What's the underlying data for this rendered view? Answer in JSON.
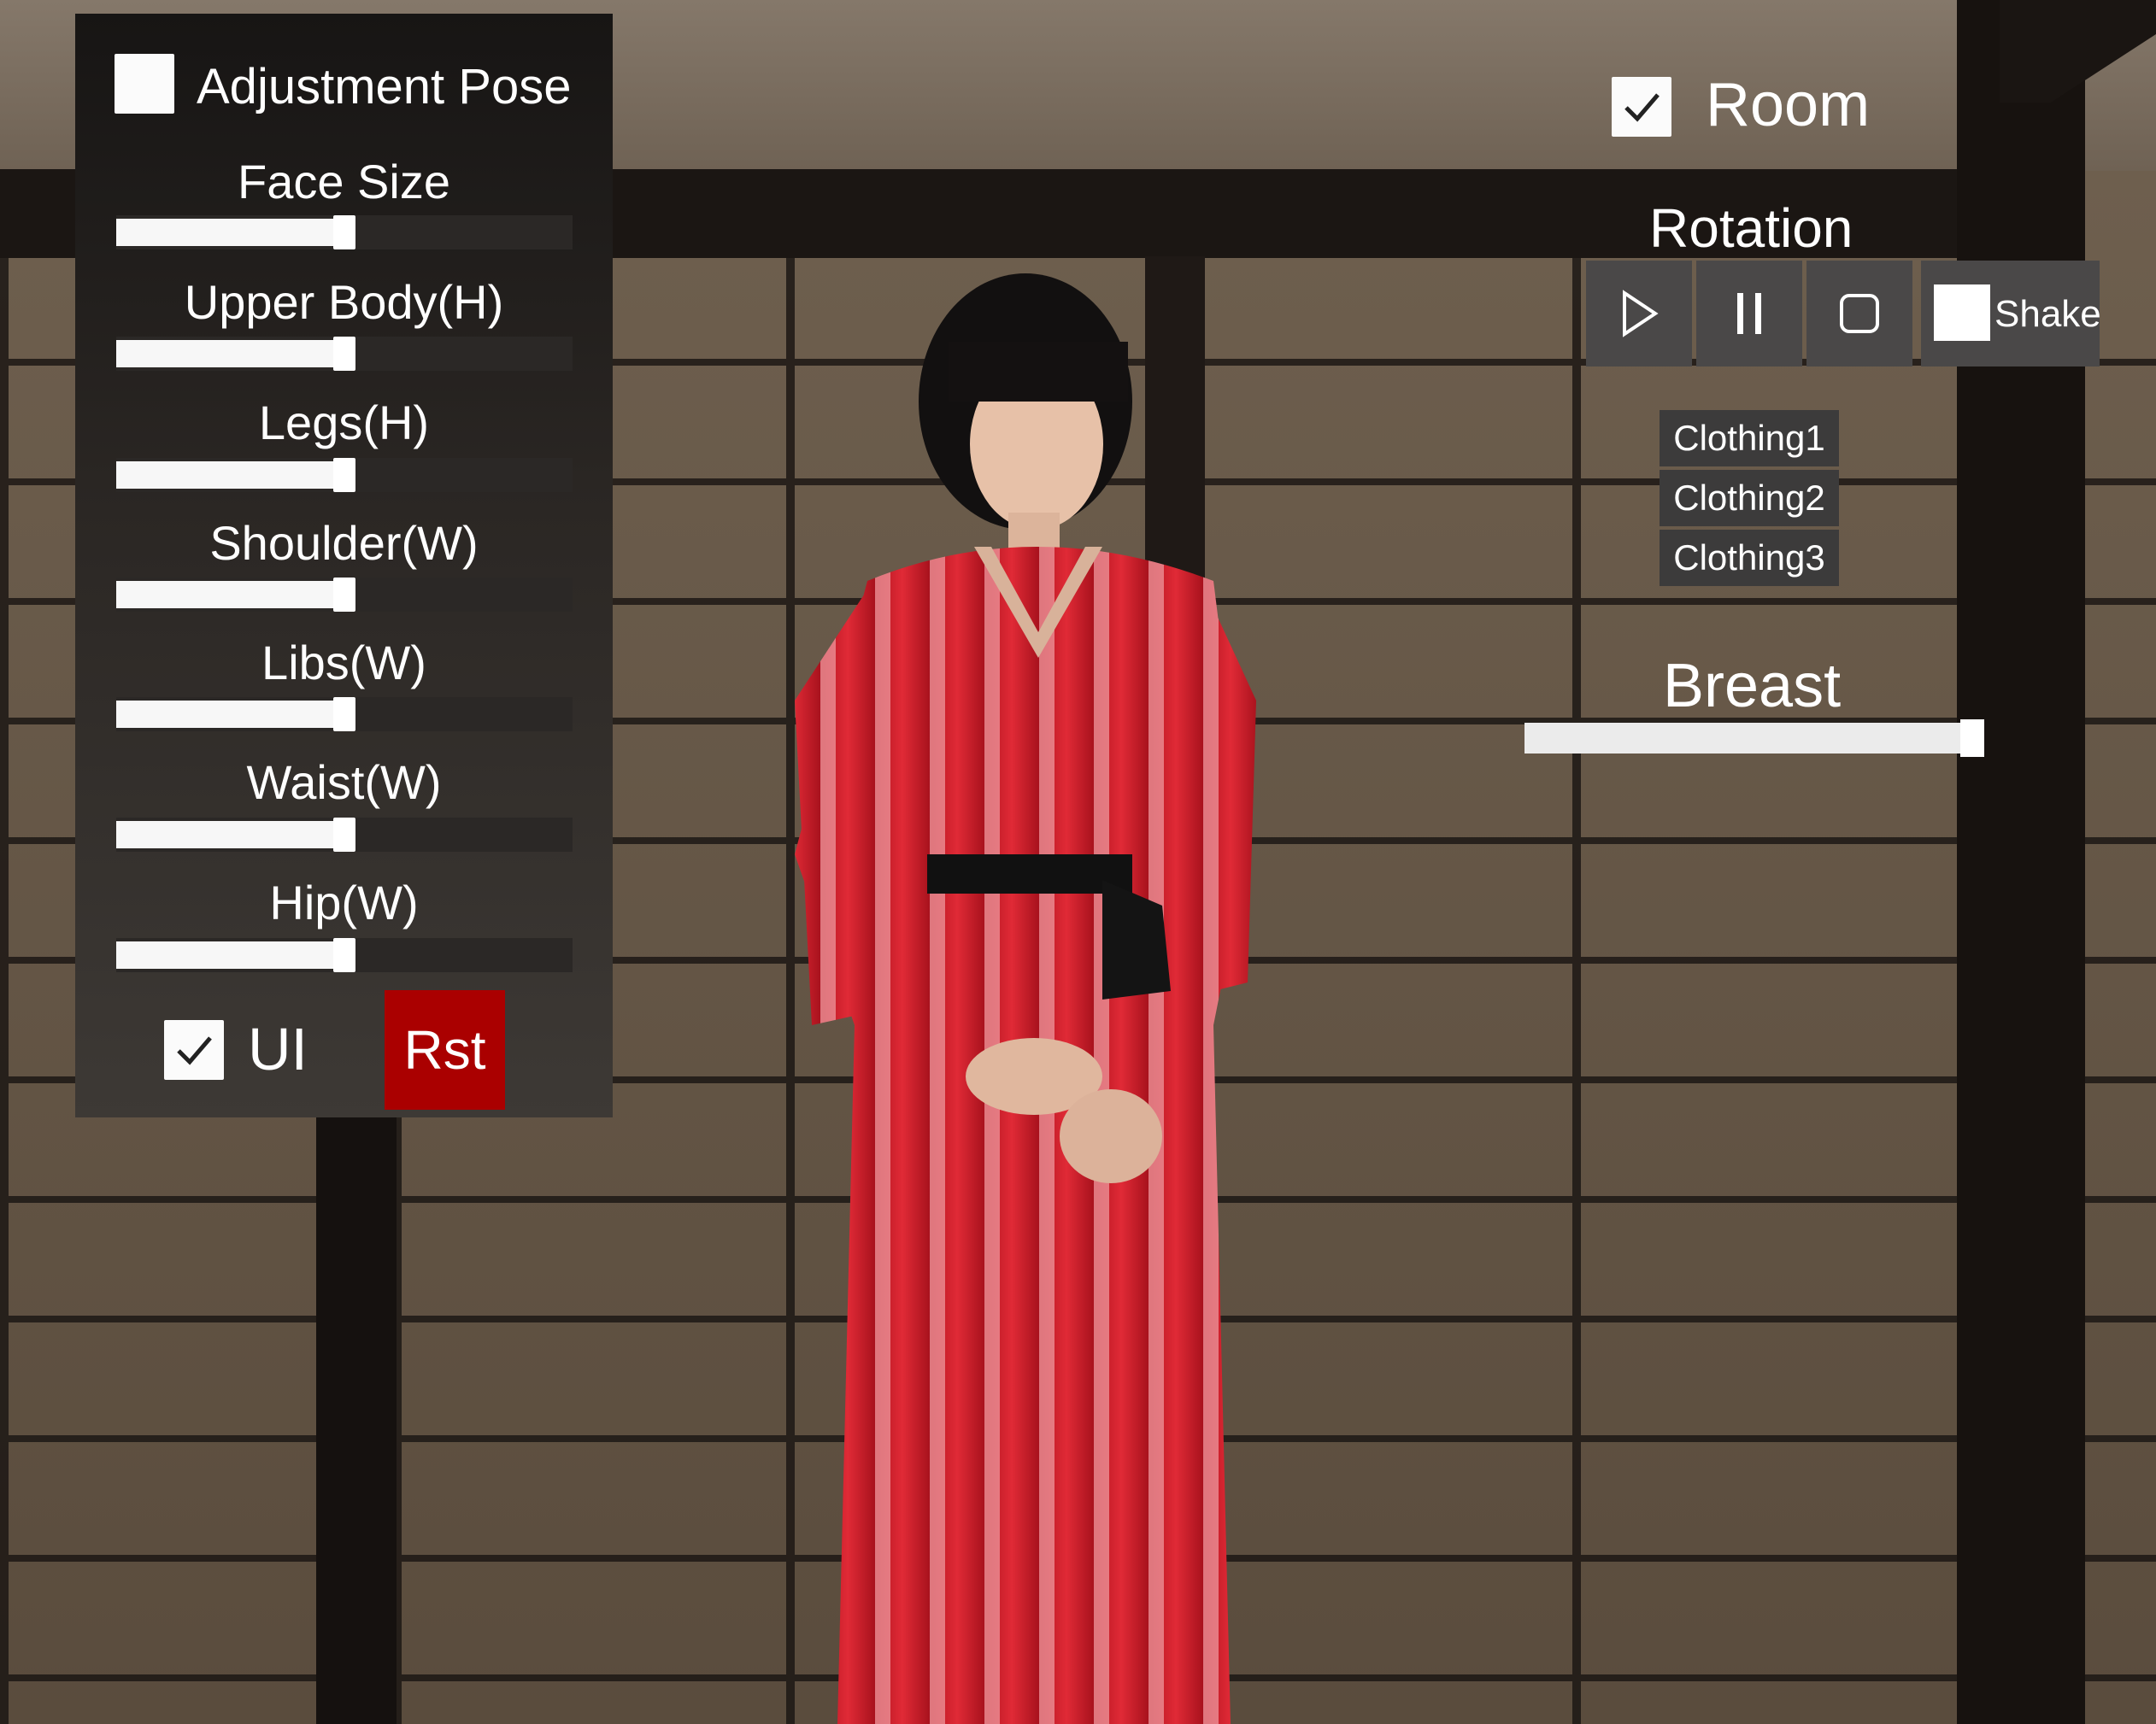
{
  "left_panel": {
    "adjustment_pose": {
      "label": "Adjustment Pose",
      "checked": false
    },
    "sliders": [
      {
        "label": "Face Size",
        "value": 0.5
      },
      {
        "label": "Upper Body(H)",
        "value": 0.5
      },
      {
        "label": "Legs(H)",
        "value": 0.5
      },
      {
        "label": "Shoulder(W)",
        "value": 0.5
      },
      {
        "label": "Libs(W)",
        "value": 0.5
      },
      {
        "label": "Waist(W)",
        "value": 0.5
      },
      {
        "label": "Hip(W)",
        "value": 0.5
      }
    ],
    "ui_toggle": {
      "label": "UI",
      "checked": true
    },
    "reset_label": "Rst"
  },
  "right_panel": {
    "room_toggle": {
      "label": "Room",
      "checked": true
    },
    "rotation": {
      "title": "Rotation",
      "buttons": [
        {
          "name": "play",
          "icon": "play-icon"
        },
        {
          "name": "pause",
          "icon": "pause-icon"
        },
        {
          "name": "stop",
          "icon": "stop-icon"
        }
      ],
      "shake": {
        "label": "Shake",
        "checked": false
      }
    },
    "clothing": [
      "Clothing1",
      "Clothing2",
      "Clothing3"
    ],
    "breast": {
      "title": "Breast",
      "value": 1.0
    }
  },
  "colors": {
    "reset_red": "#aa0000",
    "kimono_red": "#d61e2a",
    "panel_dark": "#232020"
  }
}
